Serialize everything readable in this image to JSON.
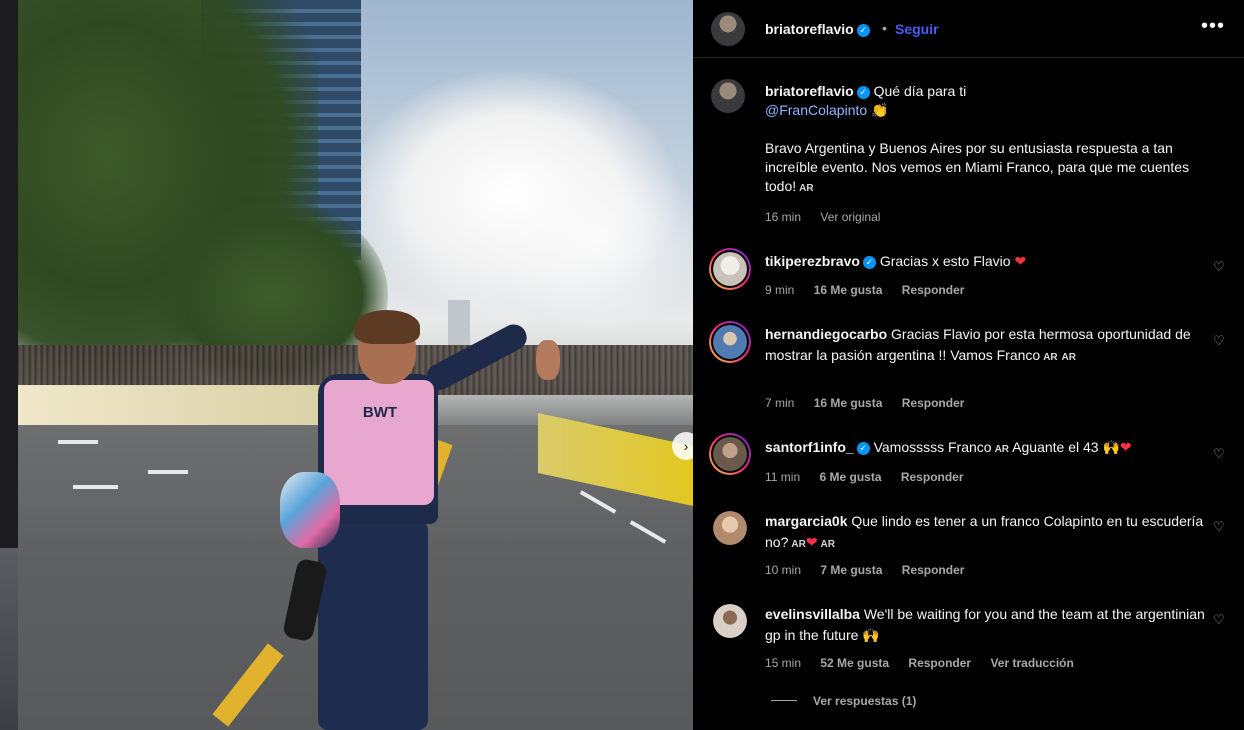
{
  "post": {
    "author": "briatoreflavio",
    "follow_label": "Seguir",
    "more_label": "•••",
    "carousel_next": "›",
    "vest_text": "BWT"
  },
  "caption": {
    "author": "briatoreflavio",
    "line1": "Qué día para ti",
    "mention": "@FranColapinto",
    "emoji1": "👏",
    "body": "Bravo Argentina y Buenos Aires por su entusiasta respuesta a tan increíble evento. Nos vemos en Miami Franco, para que me cuentes todo!",
    "flag": "AR",
    "time": "16 min",
    "see_original": "Ver original"
  },
  "comments": [
    {
      "user": "tikiperezbravo",
      "verified": true,
      "text": "Gracias x esto Flavio",
      "emoji": "❤",
      "time": "9 min",
      "likes": "16 Me gusta",
      "reply": "Responder",
      "avatar_color": "#c9c2ba"
    },
    {
      "user": "hernandiegocarbo",
      "verified": false,
      "text": "Gracias Flavio por esta hermosa oportunidad de mostrar la pasión argentina !! Vamos Franco",
      "flag1": "AR",
      "flag2": "AR",
      "time": "7 min",
      "likes": "16 Me gusta",
      "reply": "Responder",
      "avatar_color": "#4f7bb0"
    },
    {
      "user": "santorf1info_",
      "verified": true,
      "text_a": "Vamosssss Franco",
      "flag": "AR",
      "text_b": "Aguante el 43",
      "emoji": "🙌",
      "emoji2": "❤",
      "time": "11 min",
      "likes": "6 Me gusta",
      "reply": "Responder",
      "avatar_color": "#6b5a4c"
    },
    {
      "user": "margarcia0k",
      "verified": false,
      "text": "Que lindo es tener a un franco Colapinto en tu escudería no?",
      "flag1": "AR",
      "emoji": "❤",
      "flag2": "AR",
      "time": "10 min",
      "likes": "7 Me gusta",
      "reply": "Responder",
      "avatar_color": "#b08a6a"
    },
    {
      "user": "evelinsvillalba",
      "verified": false,
      "text": "We'll be waiting for you and the team at the argentinian gp in the future",
      "emoji": "🙌",
      "time": "15 min",
      "likes": "52 Me gusta",
      "reply": "Responder",
      "see_translation": "Ver traducción",
      "avatar_color": "#d9cfc6"
    }
  ],
  "view_replies": "Ver respuestas (1)",
  "icons": {
    "verified": "verified-badge-icon",
    "like": "heart-outline-icon",
    "more": "more-options-icon"
  },
  "colors": {
    "background": "#000000",
    "link": "#4a5df9",
    "mention": "#8fb4ff",
    "verified": "#0095f6",
    "heart": "#ff3040",
    "muted": "#a8a8a8"
  }
}
